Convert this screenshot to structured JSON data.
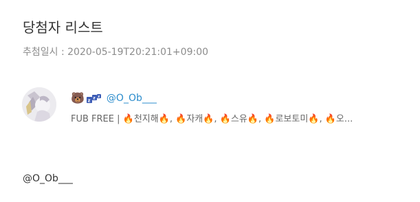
{
  "page": {
    "title": "당첨자 리스트",
    "draw_time": "추첨일시 : 2020-05-19T20:21:01+09:00"
  },
  "winners": [
    {
      "name_emoji": "🐻",
      "name_icon": "zzz-icon",
      "handle": "@O_Ob___",
      "bio": "FUB FREE | 🔥천지해🔥, 🔥자캐🔥, 🔥스유🔥, 🔥로보토미🔥, 🔥오...",
      "avatar_icon": "avatar-image"
    }
  ],
  "footer": {
    "handle_text": "@O_Ob___"
  },
  "colors": {
    "link": "#2b8ccc",
    "muted": "#8c8c8c",
    "text": "#333333"
  }
}
